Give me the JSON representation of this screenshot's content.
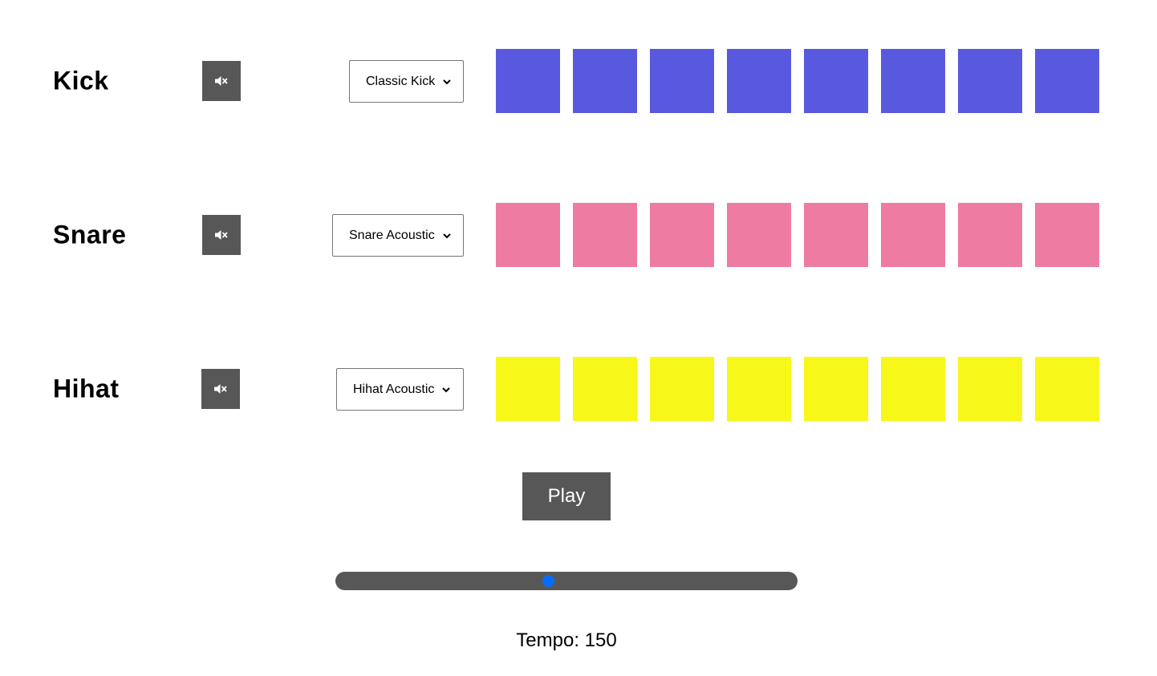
{
  "tracks": [
    {
      "name": "Kick",
      "sound": "Classic Kick",
      "color": "#5959e0",
      "muted": true,
      "steps": [
        true,
        true,
        true,
        true,
        true,
        true,
        true,
        true
      ]
    },
    {
      "name": "Snare",
      "sound": "Snare Acoustic",
      "color": "#ee7ba2",
      "muted": true,
      "steps": [
        true,
        true,
        true,
        true,
        true,
        true,
        true,
        true
      ]
    },
    {
      "name": "Hihat",
      "sound": "Hihat Acoustic",
      "color": "#f7f71a",
      "muted": true,
      "steps": [
        true,
        true,
        true,
        true,
        true,
        true,
        true,
        true
      ]
    }
  ],
  "icons": {
    "mute": "speaker-muted-icon",
    "select_arrow": "chevron-down-icon"
  },
  "controls": {
    "play_label": "Play",
    "tempo_label": "Tempo: 150",
    "tempo_fraction": 0.46,
    "slider_thumb_color": "#0a6cff",
    "button_color": "#575757"
  }
}
